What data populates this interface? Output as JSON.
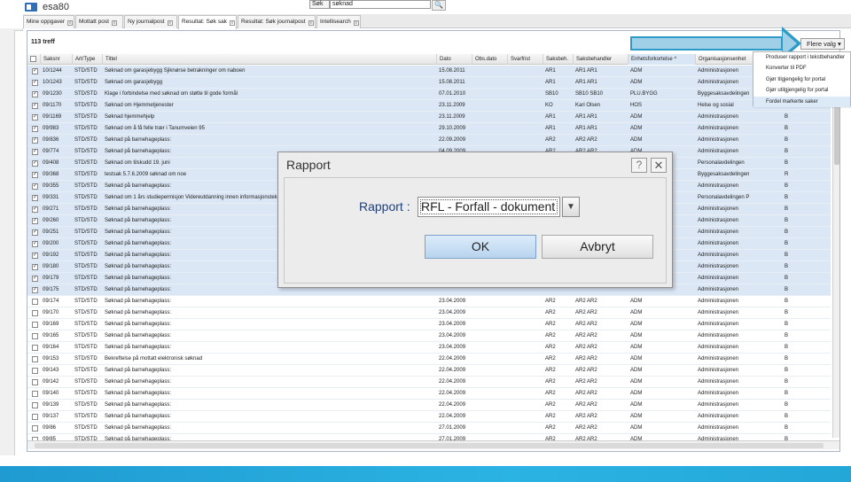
{
  "app": {
    "title": "esa80"
  },
  "search": {
    "scope": "Søk",
    "value": "søknad",
    "button": "🔍"
  },
  "tabs": [
    {
      "label": "Mine oppgaver"
    },
    {
      "label": "Mottatt post"
    },
    {
      "label": "Ny journalpost"
    },
    {
      "label": "Resultat: Søk sak"
    },
    {
      "label": "Resultat: Søk journalpost"
    },
    {
      "label": "Intellisearch"
    }
  ],
  "results": {
    "count": "113 treff",
    "more_button": "Flere valg ▾"
  },
  "menu": [
    "Produser rapport i tekstbehandler",
    "Konverter til PDF",
    "Gjør tilgjengelig for portal",
    "Gjør utilgjengelig for portal",
    "Fordel markerte saker"
  ],
  "columns": [
    "Saksnr",
    "Art/Type",
    "Tittel",
    "Dato",
    "Obs.dato",
    "Svarfrist",
    "Saksbeh.",
    "Saksbehandler",
    "Enhetsforkortelse ^",
    "Organisasjonsenhet",
    ""
  ],
  "rows": [
    {
      "sel": true,
      "c": [
        "10/1244",
        "STD/STD",
        "Søknad om garasjebygg Sjiknørse betrakninger om naboen",
        "15.08.2011",
        "",
        "",
        "AR1",
        "AR1 AR1",
        "ADM",
        "Administrasjonen",
        "B"
      ]
    },
    {
      "sel": true,
      "c": [
        "10/1243",
        "STD/STD",
        "Søknad om garasjebygg",
        "15.08.2011",
        "",
        "",
        "AR1",
        "AR1 AR1",
        "ADM",
        "Administrasjonen",
        "B"
      ]
    },
    {
      "sel": true,
      "c": [
        "09/1230",
        "STD/STD",
        "Klage i forbindelse med søknad om støtte til gode formål",
        "07.01.2010",
        "",
        "",
        "SB10",
        "SB10 SB10",
        "PLU.BYGG",
        "Byggesaksavdelingen",
        ""
      ]
    },
    {
      "sel": true,
      "c": [
        "09/1170",
        "STD/STD",
        "Søknad om Hjemmetjenester",
        "23.11.2009",
        "",
        "",
        "KO",
        "Kari Olsen",
        "HOS",
        "Helse og sosial",
        ""
      ]
    },
    {
      "sel": true,
      "c": [
        "09/1169",
        "STD/STD",
        "Søknad hjemmehjelp",
        "23.11.2009",
        "",
        "",
        "AR1",
        "AR1 AR1",
        "ADM",
        "Administrasjonen",
        "B"
      ]
    },
    {
      "sel": true,
      "c": [
        "09/983",
        "STD/STD",
        "Søknad om å få felle trær i Tanumveien 95",
        "29.10.2009",
        "",
        "",
        "AR1",
        "AR1 AR1",
        "ADM",
        "Administrasjonen",
        "B"
      ]
    },
    {
      "sel": true,
      "c": [
        "09/836",
        "STD/STD",
        "Søknad på barnehageplass:",
        "22.09.2009",
        "",
        "",
        "AR2",
        "AR2 AR2",
        "ADM",
        "Administrasjonen",
        "B"
      ]
    },
    {
      "sel": true,
      "c": [
        "09/774",
        "STD/STD",
        "Søknad på barnehageplass:",
        "04.09.2009",
        "",
        "",
        "AR2",
        "AR2 AR2",
        "ADM",
        "Administrasjonen",
        "B"
      ]
    },
    {
      "sel": true,
      "c": [
        "09/408",
        "STD/STD",
        "Søknad om tilskudd 19. juni",
        "",
        "",
        "",
        "",
        "",
        "",
        "Personalavdelingen",
        "B"
      ]
    },
    {
      "sel": true,
      "c": [
        "09/368",
        "STD/STD",
        "testsak 5.7.6.2009 søknad om noe",
        "",
        "",
        "",
        "",
        "",
        "",
        "Byggesaksavdelingen",
        "R"
      ]
    },
    {
      "sel": true,
      "c": [
        "09/355",
        "STD/STD",
        "Søknad på barnehageplass:",
        "",
        "",
        "",
        "",
        "",
        "",
        "Administrasjonen",
        "B"
      ]
    },
    {
      "sel": true,
      "c": [
        "09/331",
        "STD/STD",
        "Søknad om 1 års studiepermisjon Videreutdanning innen informasjonsteknologi",
        "",
        "",
        "",
        "",
        "",
        "",
        "Personalavdelingen    P",
        "B"
      ]
    },
    {
      "sel": true,
      "c": [
        "09/271",
        "STD/STD",
        "Søknad på barnehageplass:",
        "",
        "",
        "",
        "",
        "",
        "",
        "Administrasjonen",
        "B"
      ]
    },
    {
      "sel": true,
      "c": [
        "09/260",
        "STD/STD",
        "Søknad på barnehageplass:",
        "",
        "",
        "",
        "",
        "",
        "",
        "Administrasjonen",
        "B"
      ]
    },
    {
      "sel": true,
      "c": [
        "09/251",
        "STD/STD",
        "Søknad på barnehageplass:",
        "",
        "",
        "",
        "",
        "",
        "",
        "Administrasjonen",
        "B"
      ]
    },
    {
      "sel": true,
      "c": [
        "09/200",
        "STD/STD",
        "Søknad på barnehageplass:",
        "",
        "",
        "",
        "",
        "",
        "",
        "Administrasjonen",
        "B"
      ]
    },
    {
      "sel": true,
      "c": [
        "09/192",
        "STD/STD",
        "Søknad på barnehageplass:",
        "",
        "",
        "",
        "",
        "",
        "",
        "Administrasjonen",
        "B"
      ]
    },
    {
      "sel": true,
      "c": [
        "09/180",
        "STD/STD",
        "Søknad på barnehageplass:",
        "",
        "",
        "",
        "",
        "",
        "",
        "Administrasjonen",
        "B"
      ]
    },
    {
      "sel": true,
      "c": [
        "09/179",
        "STD/STD",
        "Søknad på barnehageplass:",
        "",
        "",
        "",
        "",
        "",
        "",
        "Administrasjonen",
        "B"
      ]
    },
    {
      "sel": true,
      "c": [
        "09/175",
        "STD/STD",
        "Søknad på barnehageplass:",
        "",
        "",
        "",
        "",
        "",
        "",
        "Administrasjonen",
        "B"
      ]
    },
    {
      "sel": false,
      "c": [
        "09/174",
        "STD/STD",
        "Søknad på barnehageplass:",
        "23.04.2009",
        "",
        "",
        "AR2",
        "AR2 AR2",
        "ADM",
        "Administrasjonen",
        "B"
      ]
    },
    {
      "sel": false,
      "c": [
        "09/170",
        "STD/STD",
        "Søknad på barnehageplass:",
        "23.04.2009",
        "",
        "",
        "AR2",
        "AR2 AR2",
        "ADM",
        "Administrasjonen",
        "B"
      ]
    },
    {
      "sel": false,
      "c": [
        "09/169",
        "STD/STD",
        "Søknad på barnehageplass:",
        "23.04.2009",
        "",
        "",
        "AR2",
        "AR2 AR2",
        "ADM",
        "Administrasjonen",
        "B"
      ]
    },
    {
      "sel": false,
      "c": [
        "09/165",
        "STD/STD",
        "Søknad på barnehageplass:",
        "23.04.2009",
        "",
        "",
        "AR2",
        "AR2 AR2",
        "ADM",
        "Administrasjonen",
        "B"
      ]
    },
    {
      "sel": false,
      "c": [
        "09/164",
        "STD/STD",
        "Søknad på barnehageplass:",
        "23.04.2009",
        "",
        "",
        "AR2",
        "AR2 AR2",
        "ADM",
        "Administrasjonen",
        "B"
      ]
    },
    {
      "sel": false,
      "c": [
        "09/153",
        "STD/STD",
        "Bekreftelse på mottatt elektronisk søknad",
        "22.04.2009",
        "",
        "",
        "AR2",
        "AR2 AR2",
        "ADM",
        "Administrasjonen",
        "B"
      ]
    },
    {
      "sel": false,
      "c": [
        "09/143",
        "STD/STD",
        "Søknad på barnehageplass:",
        "22.04.2009",
        "",
        "",
        "AR2",
        "AR2 AR2",
        "ADM",
        "Administrasjonen",
        "B"
      ]
    },
    {
      "sel": false,
      "c": [
        "09/142",
        "STD/STD",
        "Søknad på barnehageplass:",
        "22.04.2009",
        "",
        "",
        "AR2",
        "AR2 AR2",
        "ADM",
        "Administrasjonen",
        "B"
      ]
    },
    {
      "sel": false,
      "c": [
        "09/140",
        "STD/STD",
        "Søknad på barnehageplass:",
        "22.04.2009",
        "",
        "",
        "AR2",
        "AR2 AR2",
        "ADM",
        "Administrasjonen",
        "B"
      ]
    },
    {
      "sel": false,
      "c": [
        "09/139",
        "STD/STD",
        "Søknad på barnehageplass:",
        "22.04.2009",
        "",
        "",
        "AR2",
        "AR2 AR2",
        "ADM",
        "Administrasjonen",
        "B"
      ]
    },
    {
      "sel": false,
      "c": [
        "09/137",
        "STD/STD",
        "Søknad på barnehageplass:",
        "22.04.2009",
        "",
        "",
        "AR2",
        "AR2 AR2",
        "ADM",
        "Administrasjonen",
        "B"
      ]
    },
    {
      "sel": false,
      "c": [
        "09/86",
        "STD/STD",
        "Søknad på barnehageplass:",
        "27.01.2009",
        "",
        "",
        "AR2",
        "AR2 AR2",
        "ADM",
        "Administrasjonen",
        "B"
      ]
    },
    {
      "sel": false,
      "c": [
        "09/85",
        "STD/STD",
        "Søknad på barnehageplass:",
        "27.01.2009",
        "",
        "",
        "AR2",
        "AR2 AR2",
        "ADM",
        "Administrasjonen",
        "B"
      ]
    }
  ],
  "dialog": {
    "title": "Rapport",
    "help": "?",
    "close": "✕",
    "label": "Rapport :",
    "selected": "RFL - Forfall - dokument",
    "ok": "OK",
    "cancel": "Avbryt"
  },
  "colors": {
    "selected_row": "#dbe7f5",
    "accent": "#2d9ac8",
    "brand_strip": "#1f9bd1"
  }
}
